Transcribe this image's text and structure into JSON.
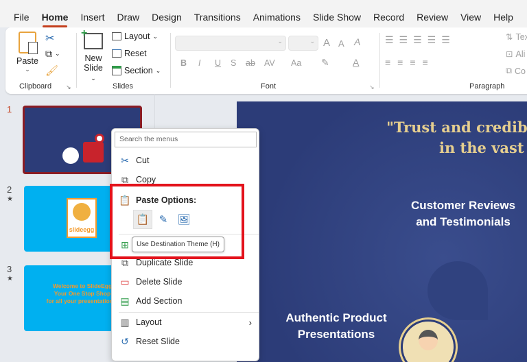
{
  "tabs": [
    "File",
    "Home",
    "Insert",
    "Draw",
    "Design",
    "Transitions",
    "Animations",
    "Slide Show",
    "Record",
    "Review",
    "View",
    "Help"
  ],
  "ribbon": {
    "clipboard": {
      "paste": "Paste",
      "label": "Clipboard"
    },
    "slides": {
      "new_slide_1": "New",
      "new_slide_2": "Slide",
      "layout": "Layout",
      "reset": "Reset",
      "section": "Section",
      "label": "Slides"
    },
    "font": {
      "label": "Font",
      "bold": "B",
      "italic": "I",
      "underline": "U",
      "shadow": "S",
      "strike": "ab",
      "spacing": "AV",
      "case": "Aa",
      "grow": "A",
      "shrink": "A"
    },
    "paragraph": {
      "label": "Paragraph",
      "text_dir": "Tex",
      "align": "Ali",
      "convert": "Co"
    }
  },
  "slides_pane": [
    {
      "number": "1",
      "selected": true
    },
    {
      "number": "2",
      "has_star": true,
      "logo_text": "slideegg"
    },
    {
      "number": "3",
      "has_star": true,
      "lines": [
        "Welcome to SlideEgg",
        "Your One Stop Shop",
        "for all your presentation n"
      ]
    }
  ],
  "slide": {
    "quote_line1": "\"Trust and credib",
    "quote_line2": "in the vast",
    "label_reviews_1": "Customer Reviews",
    "label_reviews_2": "and Testimonials",
    "label_auth_1": "Authentic Product",
    "label_auth_2": "Presentations"
  },
  "context_menu": {
    "search_placeholder": "Search the menus",
    "cut": "Cut",
    "copy": "Copy",
    "paste_options": "Paste Options:",
    "tooltip": "Use Destination Theme (H)",
    "duplicate": "Duplicate Slide",
    "delete": "Delete Slide",
    "add_section": "Add Section",
    "layout": "Layout",
    "reset": "Reset Slide"
  },
  "colors": {
    "accent": "#c43e1c",
    "highlight": "#e3121b",
    "slide_bg": "#2c3c78",
    "thumb_blue": "#00b0f0"
  }
}
